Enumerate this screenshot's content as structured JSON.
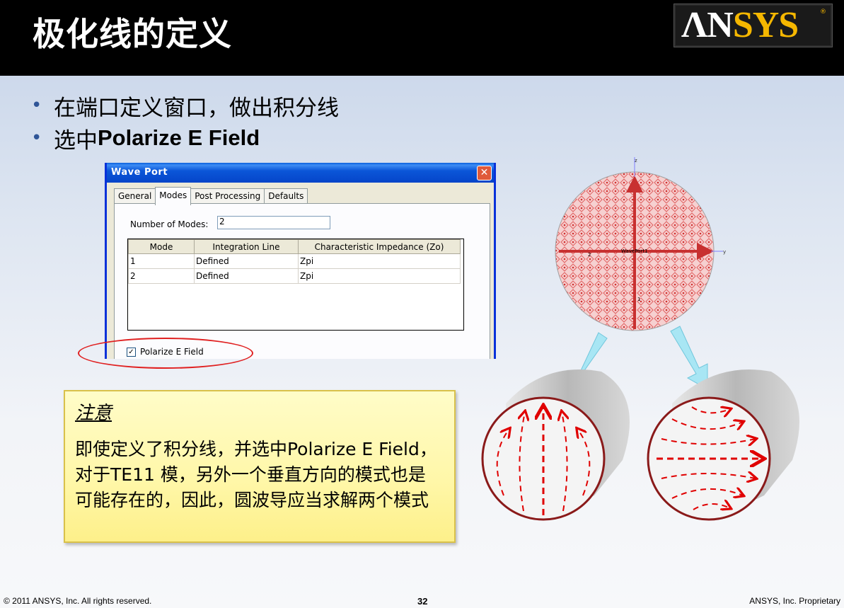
{
  "header": {
    "title": "极化线的定义",
    "logo_an": "ΛN",
    "logo_sys": "SYS",
    "logo_reg": "®"
  },
  "bullets": [
    {
      "text": "在端口定义窗口，做出积分线"
    },
    {
      "prefix": "选中",
      "bold": "Polarize E Field"
    }
  ],
  "dialog": {
    "title": "Wave Port",
    "close": "✕",
    "tabs": [
      "General",
      "Modes",
      "Post Processing",
      "Defaults"
    ],
    "active_tab": "Modes",
    "num_modes_label": "Number of Modes:",
    "num_modes_value": "2",
    "columns": [
      "Mode",
      "Integration Line",
      "Characteristic Impedance (Zo)"
    ],
    "rows": [
      [
        "1",
        "Defined",
        "Zpi"
      ],
      [
        "2",
        "Defined",
        "Zpi"
      ]
    ],
    "polarize_label": "Polarize E Field",
    "polarize_checked": "✓"
  },
  "diagram": {
    "port_label": "WavePort1",
    "axis_z": "z",
    "axis_y": "y",
    "label_1": "1",
    "label_2": "2"
  },
  "note": {
    "title": "注意",
    "body": "即使定义了积分线，并选中Polarize E Field，对于TE11 模，另外一个垂直方向的模式也是可能存在的，因此，圆波导应当求解两个模式"
  },
  "footer": {
    "copyright": "© 2011 ANSYS, Inc.  All rights reserved.",
    "page": "32",
    "proprietary": "ANSYS, Inc. Proprietary"
  }
}
